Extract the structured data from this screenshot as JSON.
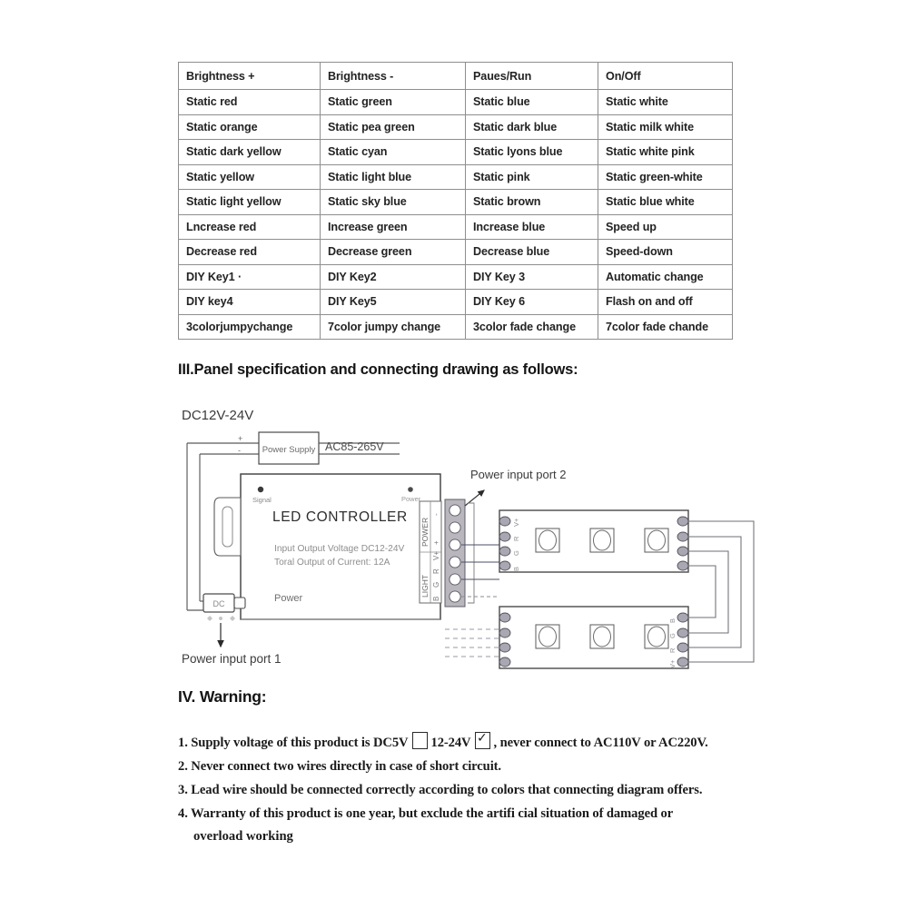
{
  "table": {
    "header": [
      "Brightness +",
      "Brightness -",
      "Paues/Run",
      "On/Off"
    ],
    "rows": [
      [
        "Static red",
        "Static green",
        "Static blue",
        "Static white"
      ],
      [
        "Static orange",
        "Static pea green",
        "Static dark blue",
        "Static milk white"
      ],
      [
        "Static dark yellow",
        "Static cyan",
        "Static lyons blue",
        "Static white pink"
      ],
      [
        "Static yellow",
        "Static light blue",
        "Static pink",
        "Static green-white"
      ],
      [
        "Static light yellow",
        "Static sky blue",
        "Static brown",
        "Static blue white"
      ],
      [
        "Lncrease red",
        "Increase green",
        "Increase blue",
        "Speed up"
      ],
      [
        "Decrease red",
        "Decrease green",
        "Decrease blue",
        "Speed-down"
      ],
      [
        "DIY Key1  ·",
        "DIY Key2",
        "DIY Key 3",
        "Automatic change"
      ],
      [
        "DIY key4",
        "DIY Key5",
        "DIY Key 6",
        "Flash on and off"
      ],
      [
        "3colorjumpychange",
        "7color jumpy change",
        "3color fade change",
        "7color fade chande"
      ]
    ]
  },
  "headings": {
    "panel": "III.Panel specification and connecting drawing as follows:",
    "warning": "IV. Warning:"
  },
  "diagram": {
    "dc_label": "DC12V-24V",
    "power_supply_label": "Power Supply",
    "ac_label": "AC85-265V",
    "plus_sign": "+",
    "minus_sign": "-",
    "controller_title": "LED CONTROLLER",
    "controller_spec_1": "Input Output Voltage DC12-24V",
    "controller_spec_2": "Toral Output of Current: 12A",
    "signal_label": "Signal",
    "power_led_label": "Power",
    "power_jack_label": "Power",
    "dc_jack_label": "DC",
    "terminal_power_group": "POWER",
    "terminal_light_group": "LIGHT",
    "terminal_power_pins": [
      "-",
      "+"
    ],
    "terminal_light_pins": [
      "B",
      "G",
      "R",
      "V+"
    ],
    "strip_pins": [
      "V+",
      "R",
      "G",
      "B"
    ],
    "port1_label": "Power input port 1",
    "port2_label": "Power input port 2"
  },
  "warnings": {
    "item1_a": "1. Supply voltage of this product is DC5V",
    "item1_b": "12-24V",
    "item1_c": ", never connect to AC110V or AC220V.",
    "item2": "2. Never connect two wires directly in case of short circuit.",
    "item3": "3. Lead wire should be connected correctly according to colors that connecting diagram offers.",
    "item4": "4. Warranty of this product is one year, but exclude the artifi cial situation of damaged or",
    "item4_cont": "overload working"
  }
}
